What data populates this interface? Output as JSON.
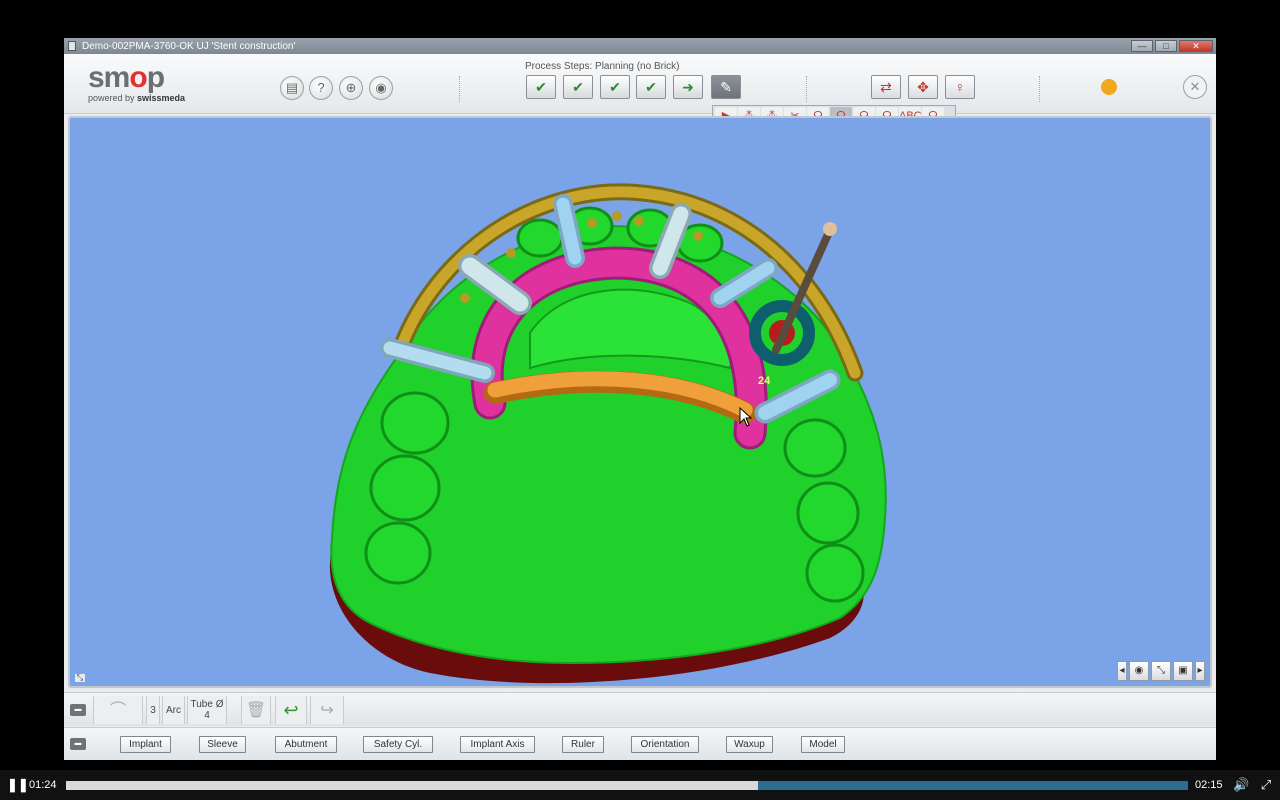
{
  "window": {
    "title": "Demo-002PMA-3760-OK   UJ 'Stent construction'",
    "min_glyph": "—",
    "max_glyph": "□",
    "close_glyph": "✕"
  },
  "logo": {
    "brand_prefix": "sm",
    "brand_o": "o",
    "brand_suffix": "p",
    "powered": "powered by ",
    "company": "swissmeda"
  },
  "toolbar": {
    "process_steps_label": "Process Steps: Planning (no Brick)",
    "icons": [
      "save-icon",
      "help-icon",
      "add-icon",
      "camera-icon"
    ],
    "glyphs": {
      "save": "▤",
      "help": "?",
      "add": "⊕",
      "camera": "◉",
      "close": "✕"
    },
    "steps_glyphs": [
      "✔",
      "✔",
      "✔",
      "✔",
      "➜",
      "✎"
    ],
    "view_glyphs": [
      "⇄",
      "✥",
      "♀"
    ],
    "status_color": "#f0a81d"
  },
  "subtoolbar": {
    "glyphs": [
      "▶",
      "⁂",
      "⁂",
      "✂",
      "☊",
      "☊",
      "☊",
      "☊",
      "ABC",
      "☊"
    ],
    "active_index": 5
  },
  "viewport": {
    "background": "#7aa3e8",
    "implant_label": "24",
    "controls": [
      "◂",
      "◉",
      "⤡",
      "▣",
      "▸"
    ],
    "resize_glyph": "⤡"
  },
  "panel1": {
    "collapse_glyph": "▬",
    "arc_icon": "⌒",
    "count": "3",
    "arc": "Arc",
    "tube_label": "Tube Ø",
    "tube_value": "4",
    "trash_glyph": "🗑",
    "undo_glyph": "↩",
    "redo_glyph": "↪"
  },
  "panel2": {
    "collapse_glyph": "▬",
    "buttons": [
      "Implant",
      "Sleeve",
      "Abutment",
      "Safety Cyl.",
      "Implant Axis",
      "Ruler",
      "Orientation",
      "Waxup",
      "Model"
    ]
  },
  "player": {
    "current_time": "01:24",
    "duration": "02:15",
    "progress": 0.617,
    "play_glyph": "❚❚",
    "volume_glyph": "🔊",
    "fullscreen_glyph": "⤢"
  }
}
